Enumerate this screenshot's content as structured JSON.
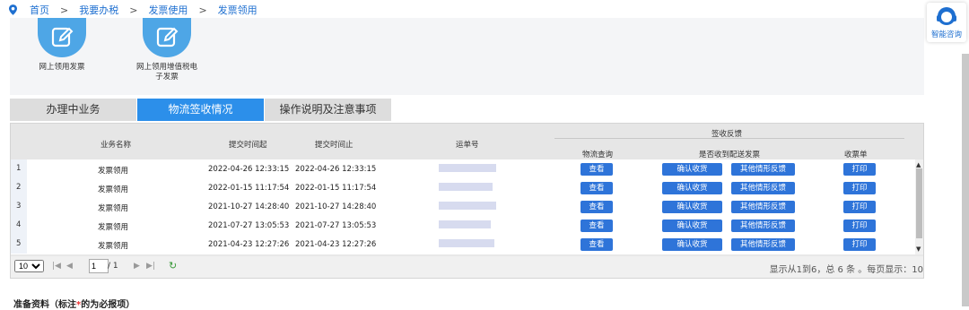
{
  "breadcrumb": {
    "items": [
      "首页",
      "我要办税",
      "发票使用",
      "发票领用"
    ]
  },
  "quick": [
    {
      "label_1": "网上领用发票",
      "label_2": ""
    },
    {
      "label_1": "网上领用增值税电",
      "label_2": "子发票"
    }
  ],
  "help": {
    "label": "智能咨询"
  },
  "tabs": [
    "办理中业务",
    "物流签收情况",
    "操作说明及注意事项"
  ],
  "table": {
    "group_header": "签收反馈",
    "headers": [
      "业务名称",
      "提交时间起",
      "提交时间止",
      "运单号",
      "物流查询",
      "是否收到配送发票",
      "收票单"
    ],
    "rows": [
      {
        "num": "1",
        "name": "发票领用",
        "start": "2022-04-26 12:33:15",
        "end": "2022-04-26 12:33:15"
      },
      {
        "num": "2",
        "name": "发票领用",
        "start": "2022-01-15 11:17:54",
        "end": "2022-01-15 11:17:54"
      },
      {
        "num": "3",
        "name": "发票领用",
        "start": "2021-10-27 14:28:40",
        "end": "2021-10-27 14:28:40"
      },
      {
        "num": "4",
        "name": "发票领用",
        "start": "2021-07-27 13:05:53",
        "end": "2021-07-27 13:05:53"
      },
      {
        "num": "5",
        "name": "发票领用",
        "start": "2021-04-23 12:27:26",
        "end": "2021-04-23 12:27:26"
      }
    ],
    "btn_view": "查看",
    "btn_confirm": "确认收货",
    "btn_other": "其他情形反馈",
    "btn_print": "打印"
  },
  "pager": {
    "page_size": "10",
    "page": "1",
    "total_pages": "/ 1",
    "summary": "显示从1到6，总 6 条 。每页显示：10"
  },
  "prep": {
    "text_before": "准备资料（标注",
    "mark": "*",
    "text_after": "的为必报项）"
  }
}
